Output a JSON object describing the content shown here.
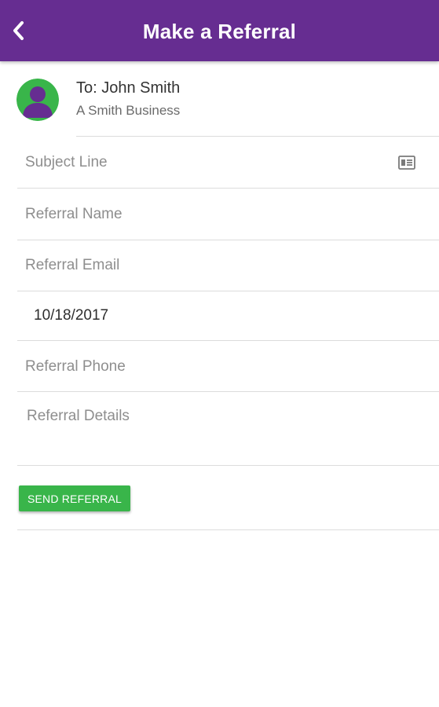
{
  "header": {
    "title": "Make a Referral",
    "back_icon": "chevron-left-icon",
    "background_color": "#662d91"
  },
  "recipient": {
    "name_line": "To: John Smith",
    "company": "A Smith Business",
    "avatar_icon": "user-avatar-icon",
    "avatar_color": "#39b54a",
    "avatar_figure_color": "#662d91"
  },
  "form": {
    "subject_placeholder": "Subject Line",
    "subject_icon": "id-card-icon",
    "name_placeholder": "Referral Name",
    "email_placeholder": "Referral Email",
    "date_value": "10/18/2017",
    "phone_placeholder": "Referral Phone",
    "details_placeholder": "Referral Details"
  },
  "actions": {
    "send_label": "SEND REFERRAL",
    "send_color": "#39b54a"
  }
}
